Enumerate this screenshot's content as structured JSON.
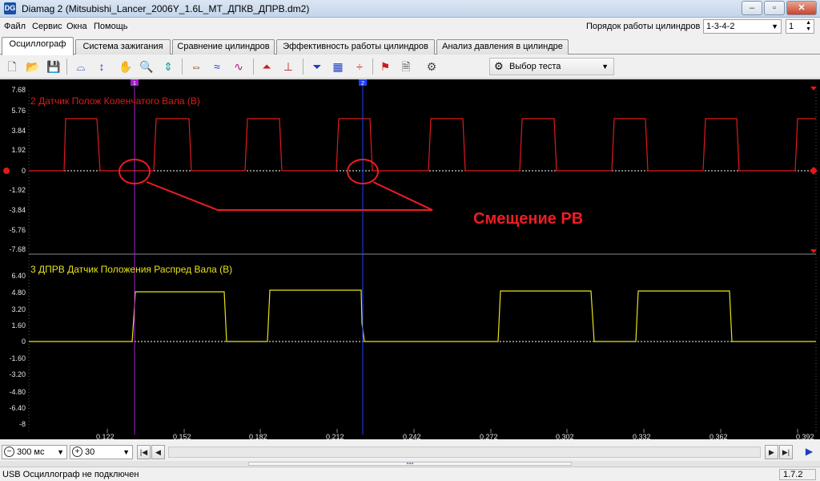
{
  "window": {
    "title": "Diamag 2 (Mitsubishi_Lancer_2006Y_1.6L_MT_ДПКВ_ДПРВ.dm2)",
    "app_icon": "DG"
  },
  "menu": {
    "items": [
      "Файл",
      "Сервис",
      "Окна",
      "Помощь"
    ]
  },
  "firing_order": {
    "label": "Порядок работы цилиндров",
    "value": "1-3-4-2",
    "cylinder": "1"
  },
  "tabs": [
    "Осциллограф",
    "Система зажигания",
    "Сравнение цилиндров",
    "Эффективность работы цилиндров",
    "Анализ давления в цилиндре"
  ],
  "toolbar": {
    "test_select_label": "Выбор теста"
  },
  "scope": {
    "channel_top": {
      "title": "2 Датчик Полож Коленчатого Вала (В)",
      "color": "#e01a1a",
      "y_ticks": [
        "7.68",
        "5.76",
        "3.84",
        "1.92",
        "0",
        "-1.92",
        "-3.84",
        "-5.76",
        "-7.68"
      ]
    },
    "channel_bottom": {
      "title": "3 ДПРВ Датчик Положения Распред Вала (В)",
      "color": "#e8e21a",
      "y_ticks": [
        "6.40",
        "4.80",
        "3.20",
        "1.60",
        "0",
        "-1.60",
        "-3.20",
        "-4.80",
        "-6.40",
        "-8"
      ]
    },
    "x_ticks": [
      "0.122",
      "0.152",
      "0.182",
      "0.212",
      "0.242",
      "0.272",
      "0.302",
      "0.332",
      "0.362",
      "0.392"
    ],
    "cursor_1_label": "1",
    "cursor_2_label": "2",
    "annotation": "Смещение РВ"
  },
  "bottom": {
    "timebase": "300 мс",
    "volts": "30"
  },
  "status": {
    "left": "USB Осциллограф не подключен",
    "version": "1.7.2"
  }
}
